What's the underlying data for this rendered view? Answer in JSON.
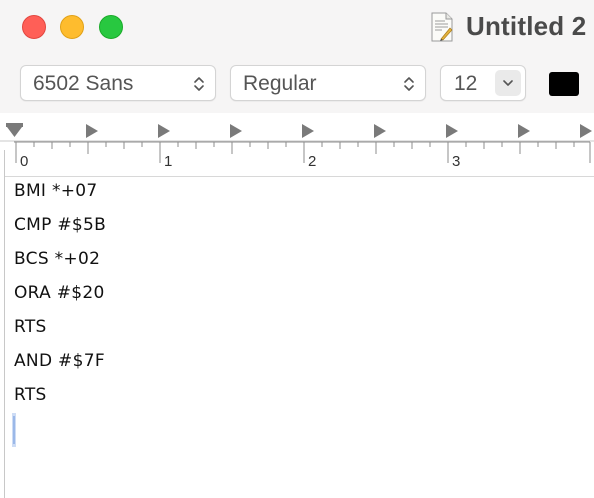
{
  "window": {
    "title": "Untitled 2"
  },
  "toolbar": {
    "font_family": "6502 Sans",
    "font_style": "Regular",
    "font_size": "12",
    "text_color": "#000000"
  },
  "ruler": {
    "labels": [
      "0",
      "1",
      "2",
      "3"
    ]
  },
  "document": {
    "lines": [
      "BMI *+07",
      "CMP #$5B",
      "BCS *+02",
      "ORA #$20",
      "RTS",
      "AND #$7F",
      "RTS"
    ]
  },
  "colors": {
    "close": "#ff5f57",
    "minimize": "#febc2e",
    "maximize": "#28c840",
    "selection": "#cddcf5"
  }
}
